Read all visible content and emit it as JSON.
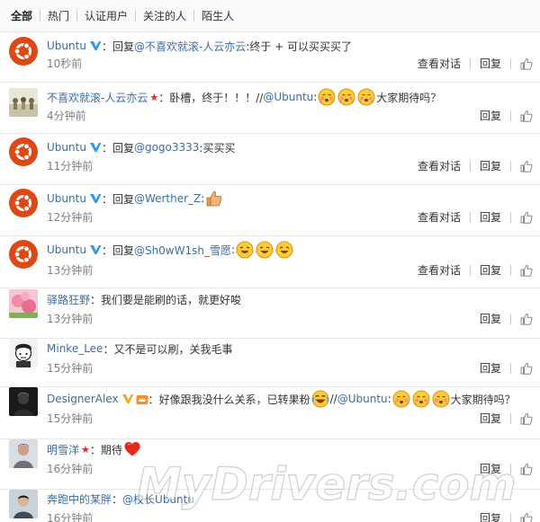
{
  "tabs": [
    "全部",
    "热门",
    "认证用户",
    "关注的人",
    "陌生人"
  ],
  "actions": {
    "view_conversation": "查看对话",
    "reply": "回复"
  },
  "comments": [
    {
      "user": "Ubuntu",
      "sep": "：",
      "text_before": "回复",
      "mention": "@不喜欢就滚-人云亦云",
      "text_after": ":终于 + 可以买买买了",
      "time": "10秒前"
    },
    {
      "user": "不喜欢就滚-人云亦云",
      "sep": "：",
      "text_before": "卧槽，终于！！！//",
      "mention": "@Ubuntu",
      "text_after": ":",
      "text_tail": "大家期待吗？",
      "time": "4分钟前"
    },
    {
      "user": "Ubuntu",
      "sep": "：",
      "text_before": "回复",
      "mention": "@gogo3333",
      "text_after": ":买买买",
      "time": "11分钟前"
    },
    {
      "user": "Ubuntu",
      "sep": "：",
      "text_before": "回复",
      "mention": "@Werther_Z",
      "text_after": ":",
      "time": "12分钟前"
    },
    {
      "user": "Ubuntu",
      "sep": "：",
      "text_before": "回复",
      "mention": "@Sh0wW1sh_雪愿",
      "text_after": ":",
      "time": "13分钟前"
    },
    {
      "user": "驿路狂野",
      "sep": "：",
      "text_before": "我们要是能刷的话，就更好唆",
      "time": "13分钟前"
    },
    {
      "user": "Minke_Lee",
      "sep": "：",
      "text_before": "又不是可以刷，关我毛事",
      "time": "15分钟前"
    },
    {
      "user": "DesignerAlex",
      "sep": "：",
      "text_before": "好像跟我没什么关系，已转果粉",
      "text_mid": "//",
      "mention": "@Ubuntu",
      "text_after": ":",
      "text_tail": "大家期待吗？",
      "time": "15分钟前"
    },
    {
      "user": "明雪洋",
      "sep": "：",
      "text_before": "期待",
      "time": "16分钟前"
    },
    {
      "user": "奔跑中的某胖",
      "sep": "：",
      "mention": "@校长Ubuntu",
      "time": "16分钟前"
    }
  ],
  "watermark": "MyDrivers.com",
  "colors": {
    "link": "#3a6ea5",
    "time": "#808080",
    "verified": "#2d9bf0",
    "star": "#e8261b",
    "ubuntu": "#dd4814"
  }
}
